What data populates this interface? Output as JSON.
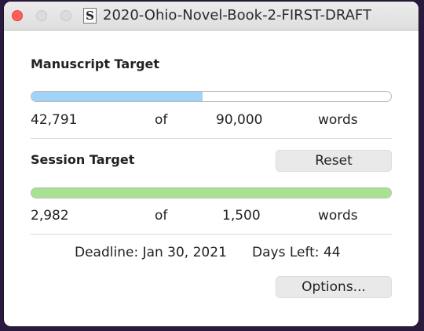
{
  "window": {
    "title": "2020-Ohio-Novel-Book-2-FIRST-DRAFT",
    "doc_icon_glyph": "S"
  },
  "manuscript": {
    "heading": "Manuscript Target",
    "current": "42,791",
    "of": "of",
    "target": "90,000",
    "unit": "words",
    "progress_fraction": 0.4755
  },
  "session": {
    "heading": "Session Target",
    "reset_label": "Reset",
    "current": "2,982",
    "of": "of",
    "target": "1,500",
    "unit": "words",
    "progress_fraction": 1.0
  },
  "deadline": {
    "text": "Deadline: Jan 30, 2021",
    "days_left": "Days Left: 44"
  },
  "options_label": "Options...",
  "colors": {
    "manuscript_bar": "#9fd3f7",
    "session_bar": "#a6e28f",
    "close_button": "#ff5f57"
  }
}
